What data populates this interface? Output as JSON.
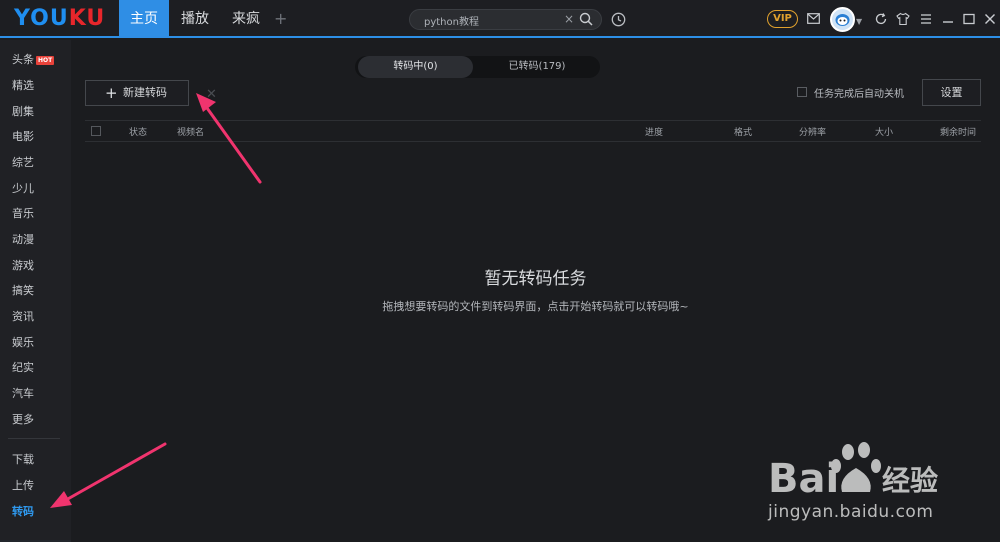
{
  "app": {
    "logo": "YOUKU",
    "logo_part1": "YOU",
    "logo_part2": "KU"
  },
  "nav": {
    "tabs": [
      {
        "label": "主页",
        "active": true
      },
      {
        "label": "播放",
        "active": false
      },
      {
        "label": "来疯",
        "active": false
      }
    ],
    "add_tab_icon": "plus-icon"
  },
  "search": {
    "value": "python教程",
    "clear_glyph": "×"
  },
  "header_right": {
    "vip_label": "VIP"
  },
  "sidebar": {
    "items": [
      {
        "label": "头条"
      },
      {
        "label": "精选"
      },
      {
        "label": "剧集"
      },
      {
        "label": "电影"
      },
      {
        "label": "综艺"
      },
      {
        "label": "少儿"
      },
      {
        "label": "音乐"
      },
      {
        "label": "动漫"
      },
      {
        "label": "游戏"
      },
      {
        "label": "搞笑"
      },
      {
        "label": "资讯"
      },
      {
        "label": "娱乐"
      },
      {
        "label": "纪实"
      },
      {
        "label": "汽车"
      },
      {
        "label": "更多"
      }
    ],
    "hot_badge": "HOT",
    "bottom_items": [
      {
        "label": "下载"
      },
      {
        "label": "上传"
      },
      {
        "label": "转码",
        "active": true
      }
    ]
  },
  "transcode": {
    "segments": [
      {
        "label": "转码中(0)",
        "active": true
      },
      {
        "label": "已转码(179)",
        "active": false
      }
    ],
    "new_button": "新建转码",
    "auto_shutdown_label": "任务完成后自动关机",
    "settings_button": "设置",
    "columns": [
      "状态",
      "视频名",
      "进度",
      "格式",
      "分辨率",
      "大小",
      "剩余时间"
    ],
    "empty_title": "暂无转码任务",
    "empty_desc": "拖拽想要转码的文件到转码界面，点击开始转码就可以转码哦~"
  },
  "watermark": {
    "brand": "Bai",
    "brand_cn": "经验",
    "url": "jingyan.baidu.com"
  },
  "colors": {
    "accent": "#2f8ee5",
    "annotation_arrow": "#f0346e",
    "vip": "#e0a12d",
    "hot": "#e8423a"
  }
}
